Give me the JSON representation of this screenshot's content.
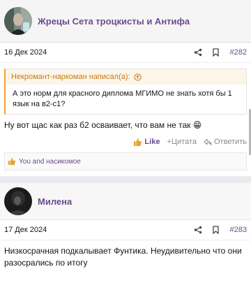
{
  "colors": {
    "accent": "#6a4d8b",
    "quote_accent": "#c77c16",
    "quote_border": "#f0a030"
  },
  "posts": [
    {
      "username": "Жрецы Сета троцкисты и Антифа",
      "date": "16 Дек 2024",
      "post_number": "#282",
      "quote_author": "Некромант-наркоман написал(а):",
      "quote_text": "А это норм для красного диплома МГИМО не знать хотя бы 1 язык на в2-с1?",
      "message": "Ну вот щас как раз б2 осваивает, что вам не так 😁",
      "like_label": "Like",
      "quote_label": "+Цитата",
      "reply_label": "Ответить",
      "reactions_text": "You and насикомое"
    },
    {
      "username": "Милена",
      "date": "17 Дек 2024",
      "post_number": "#283",
      "message": "Низкосрачная подкалывает Фунтика. Неудивительно что они разосрались по итогу"
    }
  ]
}
